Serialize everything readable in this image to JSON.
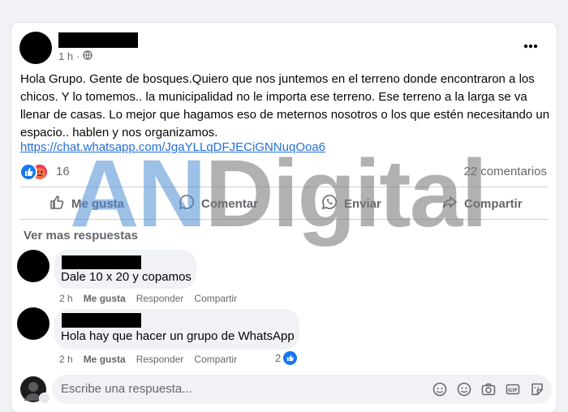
{
  "post": {
    "time": "1 h",
    "body_lines": [
      "Hola Grupo. Gente de bosques.Quiero que nos juntemos en el terreno donde encontraron a los",
      "chicos. Y lo tomemos..  la municipalidad no le importa ese terreno. Ese terreno a la larga se va",
      "llenar de casas. Lo mejor que hagamos eso de meternos nosotros o los que estén necesitando un",
      "espacio..  hablen y nos organizamos."
    ],
    "link": "https://chat.whatsapp.com/JgaYLLqDFJECiGNNuqOoa6",
    "reaction_count": "16",
    "comments_count": "22 comentarios",
    "more_icon": "more-horizontal-icon",
    "globe_icon": "globe-icon"
  },
  "actions": {
    "like": "Me gusta",
    "comment": "Comentar",
    "send": "Enviar",
    "share": "Compartir"
  },
  "comments_section": {
    "see_more": "Ver mas respuestas",
    "comments": [
      {
        "text": "Dale 10 x 20 y copamos",
        "time": "2 h",
        "like": "Me gusta",
        "reply": "Responder",
        "share": "Compartir"
      },
      {
        "text": "Hola hay que hacer un grupo de WhatsApp",
        "time": "2 h",
        "like": "Me gusta",
        "reply": "Responder",
        "share": "Compartir",
        "likes": "2"
      }
    ]
  },
  "reply": {
    "placeholder": "Escribe una respuesta..."
  },
  "watermark": {
    "part1": "AN",
    "part2": "Digital"
  },
  "colors": {
    "like_blue": "#1877f2",
    "link_blue": "#216fdb",
    "angry_red": "#e9710f",
    "muted_text": "#65676b"
  }
}
